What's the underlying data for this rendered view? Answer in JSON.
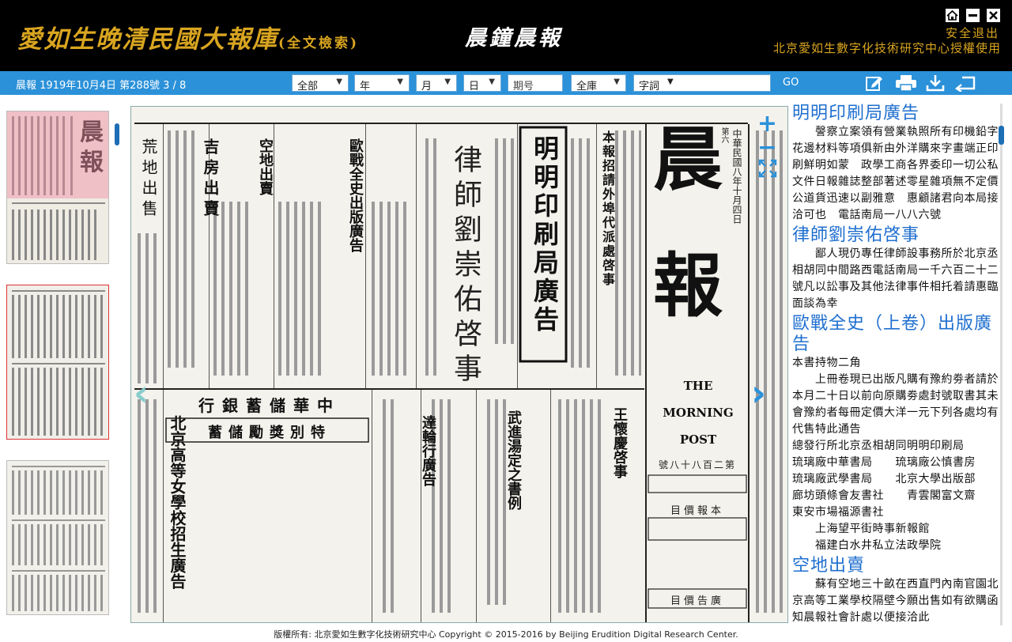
{
  "header": {
    "title": "愛如生晚清民國大報庫",
    "subtitle": "(全文檢索)",
    "paper_name": "晨鐘晨報",
    "logout": "安全退出",
    "license": "北京愛如生數字化技術研究中心授權使用",
    "icons": [
      "home-icon",
      "minimize-icon",
      "close-icon"
    ]
  },
  "toolbar": {
    "issue_info": "晨報 1919年10月4日 第288號 3 / 8",
    "selects": [
      "全部",
      "年",
      "月",
      "日"
    ],
    "issue_no_placeholder": "期号",
    "scope": "全庫",
    "keyword": "字詞",
    "go": "GO",
    "icons": [
      "edit-icon",
      "print-icon",
      "download-icon",
      "return-icon"
    ]
  },
  "viewer": {
    "zoom_in": "+",
    "zoom_out": "−",
    "next": "›",
    "prev": "‹",
    "masthead": [
      "晨",
      "報"
    ],
    "english_name": [
      "THE",
      "MORNING",
      "POST"
    ],
    "headline_printing": "明明印刷局廣告",
    "headline_lawyer": "律師劉崇佑啓事",
    "headline_war": "歐戰全史出版廣告",
    "headline_land": "空地出賣",
    "headline_house": "吉房出賣",
    "headline_desert": "荒地出售",
    "headline_bank": "中華儲蓄銀行",
    "headline_prize": "特別獎勵儲蓄",
    "headline_wuyi": "武進湯定之書例",
    "headline_dalun": "達輪行廣告",
    "headline_wang": "王懷慶啓事",
    "headline_school": "北京高等女學校招生廣告",
    "headline_recruit": "本報招請外埠代派處啓事",
    "date_line": "中華民國八年十月四日",
    "page_label": "第六",
    "issue_box": "第二百八十八號",
    "price_head": "本報價目",
    "ad_head": "廣告價目"
  },
  "articles": [
    {
      "title": "明明印刷局廣告",
      "body": "　　謦察立案領有營業執照所有印機鉛字花邊材料等項俱新由外洋購來字畫端正印刷鮮明如蒙　政學工商各界委印一切公私文件日報雜誌整部著述零星雜項無不定價公道貨迅速以副雅意　惠顧諸君向本局接洽可也　電話南局一八八六號"
    },
    {
      "title": "律師劉崇佑啓事",
      "body": "　　鄙人現仍專任律師設事務所於北京丞相胡同中間路西電話南局一千六百二十二號凡以訟事及其他法律事件相托着請惠臨面談為幸"
    },
    {
      "title": "歐戰全史（上卷）出版廣告",
      "body": "本書持物二角\n　　上冊卷現已出版凡購有豫約劵者請於本月二十日以前向原購劵處封號取書其未會豫約者每冊定價大洋一元下列各處均有代售特此通告\n總發行所北京丞相胡同明明印刷局\n琉璃廠中華書局　　琉璃廠公慎書房\n琉璃廠武學書局　　北京大學出版部\n廊坊頭條會友書社　　青雲閣富文齋\n東安市場福源書社\n　　上海望平街時事新報館\n　　福建白水井私立法政學院"
    },
    {
      "title": "空地出賣",
      "body": "　　蘇有空地三十畝在西直門內南官園北京高等工業學校隔壁今願出售如有欲購函知晨報社會計處以便接洽此"
    }
  ],
  "footer": "版權所有: 北京愛如生數字化技術研究中心 Copyright © 2015-2016 by Beijing Erudition Digital Research Center.",
  "colors": {
    "header_bg": "#000000",
    "gold": "#d9a520",
    "toolbar_blue": "#2b91d9",
    "link_blue": "#1f6fcf"
  }
}
